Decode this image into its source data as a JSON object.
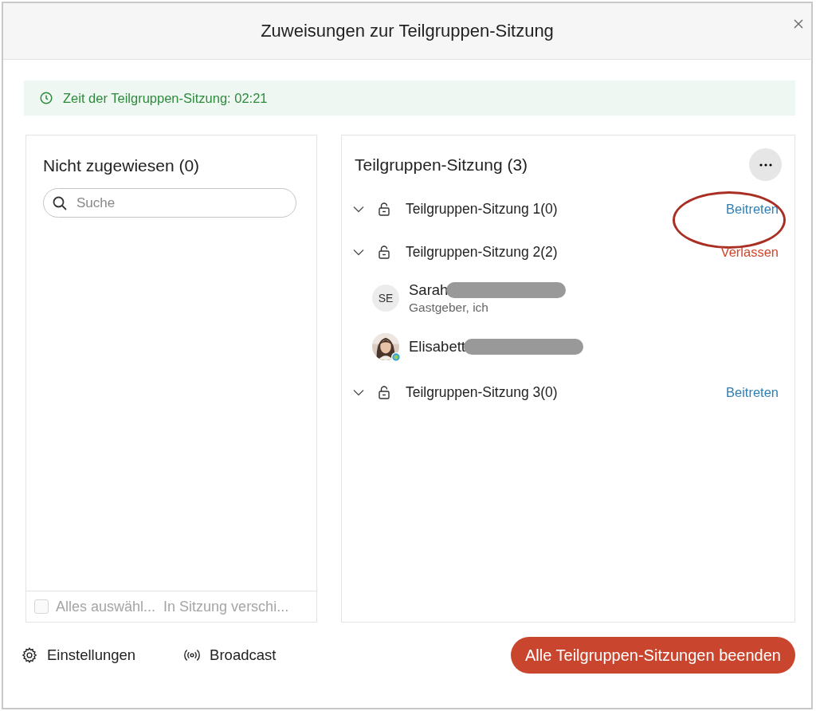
{
  "window": {
    "title": "Zuweisungen zur Teilgruppen-Sitzung"
  },
  "timer_banner": {
    "text": "Zeit der Teilgruppen-Sitzung: 02:21"
  },
  "unassigned": {
    "title": "Nicht zugewiesen (0)",
    "search": {
      "placeholder": "Suche"
    },
    "select_all": {
      "label": "Alles auswähl...",
      "checked": false,
      "disabled": true
    },
    "move_button": {
      "label": "In Sitzung verschi...",
      "disabled": true
    }
  },
  "sessions_panel": {
    "title": "Teilgruppen-Sitzung (3)",
    "sessions": [
      {
        "name": "Teilgruppen-Sitzung 1(0)",
        "expanded": true,
        "circled": true,
        "action": {
          "kind": "join",
          "label": "Beitreten"
        }
      },
      {
        "name": "Teilgruppen-Sitzung 2(2)",
        "expanded": true,
        "circled": false,
        "action": {
          "kind": "leave",
          "label": "Verlassen"
        },
        "members": [
          {
            "name": "Sarah",
            "redacted": true,
            "role": "Gastgeber, ich",
            "avatar": {
              "kind": "initials",
              "text": "SE"
            },
            "online": false
          },
          {
            "name": "Elisabett",
            "redacted": true,
            "online": true
          }
        ]
      },
      {
        "name": "Teilgruppen-Sitzung 3(0)",
        "expanded": true,
        "circled": false,
        "action": {
          "kind": "join",
          "label": "Beitreten"
        }
      }
    ]
  },
  "footer": {
    "settings": "Einstellungen",
    "broadcast": "Broadcast",
    "end_all": "Alle Teilgruppen-Sitzungen beenden"
  }
}
